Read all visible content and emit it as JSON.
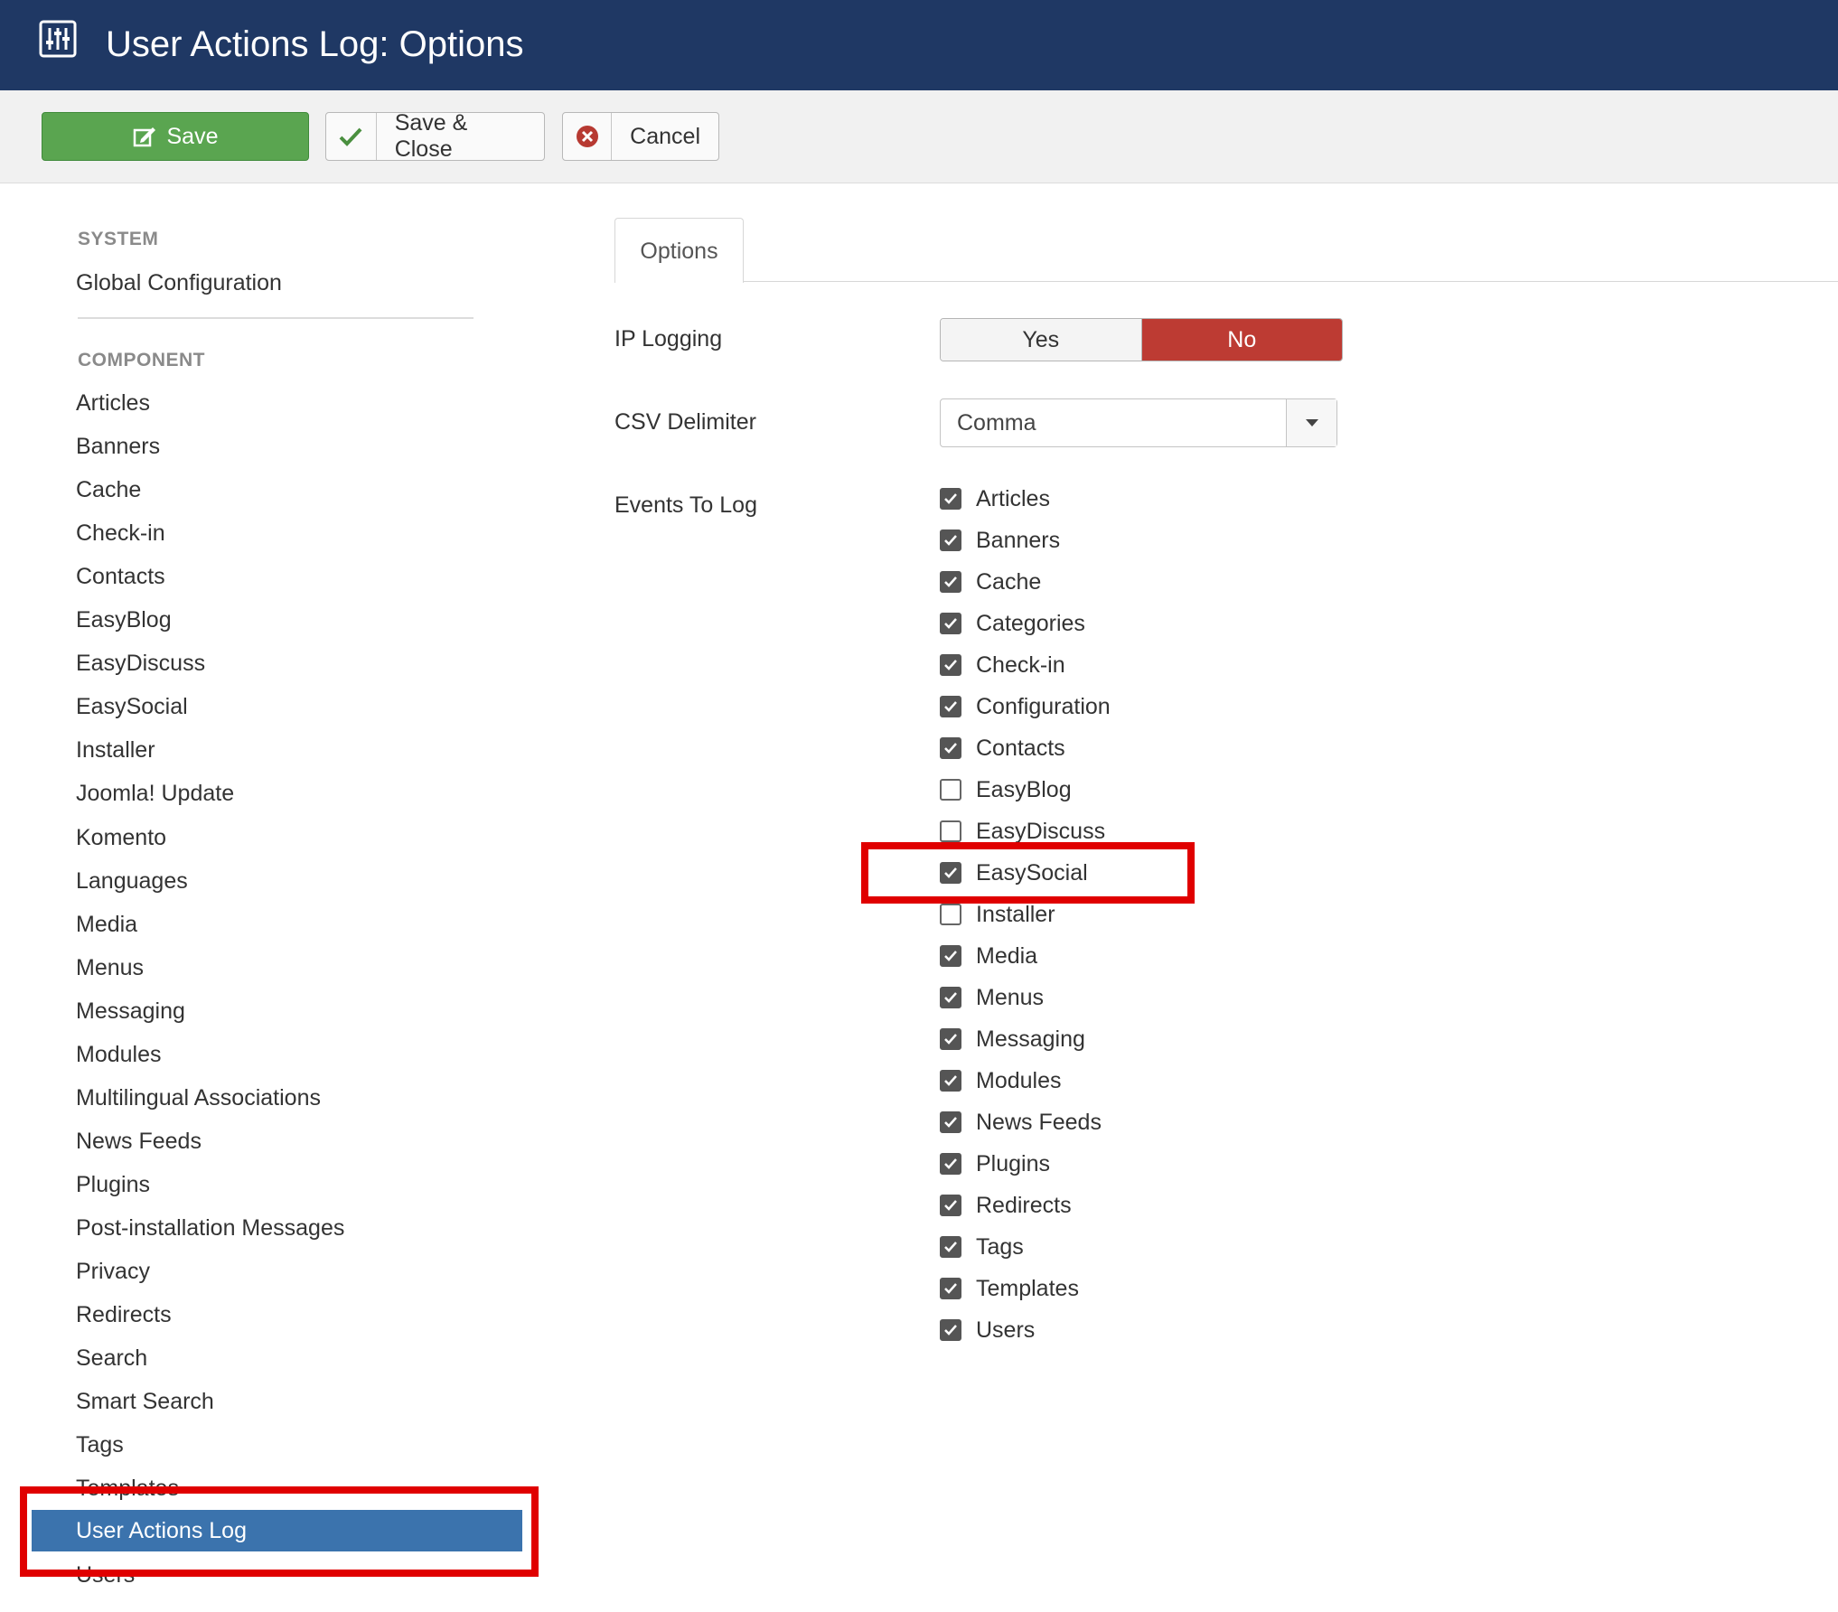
{
  "header": {
    "title": "User Actions Log: Options",
    "icon": "sliders-icon"
  },
  "toolbar": {
    "save_label": "Save",
    "save_close_label": "Save & Close",
    "cancel_label": "Cancel"
  },
  "sidebar": {
    "system_heading": "SYSTEM",
    "global_config": "Global Configuration",
    "component_heading": "COMPONENT",
    "items": [
      "Articles",
      "Banners",
      "Cache",
      "Check-in",
      "Contacts",
      "EasyBlog",
      "EasyDiscuss",
      "EasySocial",
      "Installer",
      "Joomla! Update",
      "Komento",
      "Languages",
      "Media",
      "Menus",
      "Messaging",
      "Modules",
      "Multilingual Associations",
      "News Feeds",
      "Plugins",
      "Post-installation Messages",
      "Privacy",
      "Redirects",
      "Search",
      "Smart Search",
      "Tags",
      "Templates",
      "User Actions Log",
      "Users"
    ],
    "active_item": "User Actions Log"
  },
  "main": {
    "tab_label": "Options",
    "ip_logging": {
      "label": "IP Logging",
      "yes": "Yes",
      "no": "No",
      "selected": "No"
    },
    "csv_delimiter": {
      "label": "CSV Delimiter",
      "value": "Comma"
    },
    "events": {
      "label": "Events To Log",
      "items": [
        {
          "label": "Articles",
          "checked": true
        },
        {
          "label": "Banners",
          "checked": true
        },
        {
          "label": "Cache",
          "checked": true
        },
        {
          "label": "Categories",
          "checked": true
        },
        {
          "label": "Check-in",
          "checked": true
        },
        {
          "label": "Configuration",
          "checked": true
        },
        {
          "label": "Contacts",
          "checked": true
        },
        {
          "label": "EasyBlog",
          "checked": false
        },
        {
          "label": "EasyDiscuss",
          "checked": false
        },
        {
          "label": "EasySocial",
          "checked": true
        },
        {
          "label": "Installer",
          "checked": false
        },
        {
          "label": "Media",
          "checked": true
        },
        {
          "label": "Menus",
          "checked": true
        },
        {
          "label": "Messaging",
          "checked": true
        },
        {
          "label": "Modules",
          "checked": true
        },
        {
          "label": "News Feeds",
          "checked": true
        },
        {
          "label": "Plugins",
          "checked": true
        },
        {
          "label": "Redirects",
          "checked": true
        },
        {
          "label": "Tags",
          "checked": true
        },
        {
          "label": "Templates",
          "checked": true
        },
        {
          "label": "Users",
          "checked": true
        }
      ]
    }
  },
  "colors": {
    "header_bg": "#1f3864",
    "save_green": "#5aa550",
    "no_red": "#bd3b33",
    "active_blue": "#3b73ad",
    "highlight_red": "#e00000"
  }
}
